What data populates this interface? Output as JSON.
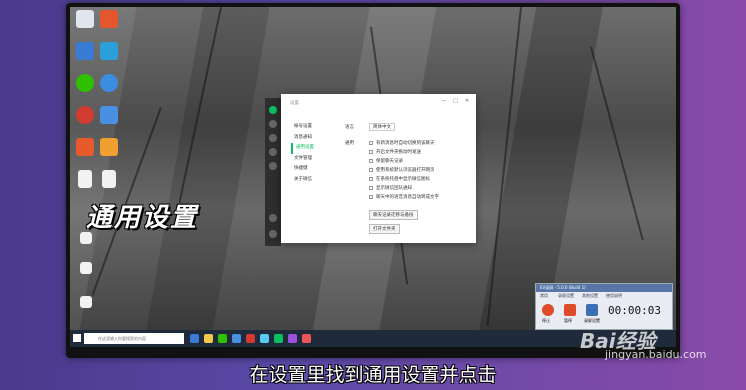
{
  "overlay": {
    "big_caption": "通用设置",
    "subtitle": "在设置里找到通用设置并点击",
    "watermark": "Bai经验",
    "watermark_url": "jingyan.baidu.com"
  },
  "dialog": {
    "title": "设置",
    "controls": [
      "—",
      "□",
      "✕"
    ],
    "nav": [
      "帐号设置",
      "消息通知",
      "通用设置",
      "文件管理",
      "快捷键",
      "关于微信"
    ],
    "active_nav": "通用设置",
    "language_label": "语言",
    "language_value": "简体中文",
    "general_label": "通用",
    "options": [
      "有新消息时自动切换到该聊天",
      "开启文件夹拖动时发送",
      "保留聊天记录",
      "使用系统默认浏览器打开网页",
      "在系统托盘中显示微信图标",
      "显示微信团队通知",
      "聊天中的语音消息自动转成文字"
    ],
    "button_1": "聊天记录迁移与备份",
    "button_2": "打开文件夹"
  },
  "taskbar": {
    "search_placeholder": "在这里输入你要搜索的内容"
  },
  "recorder": {
    "title": "EV录屏 - 5.0.0 (Build 1)",
    "tabs": [
      "常用",
      "录屏设置",
      "其他设置",
      "使用说明"
    ],
    "time": "00:00:03",
    "stop_label": "停止",
    "pause_label": "暂停",
    "settings_label": "录屏设置"
  }
}
